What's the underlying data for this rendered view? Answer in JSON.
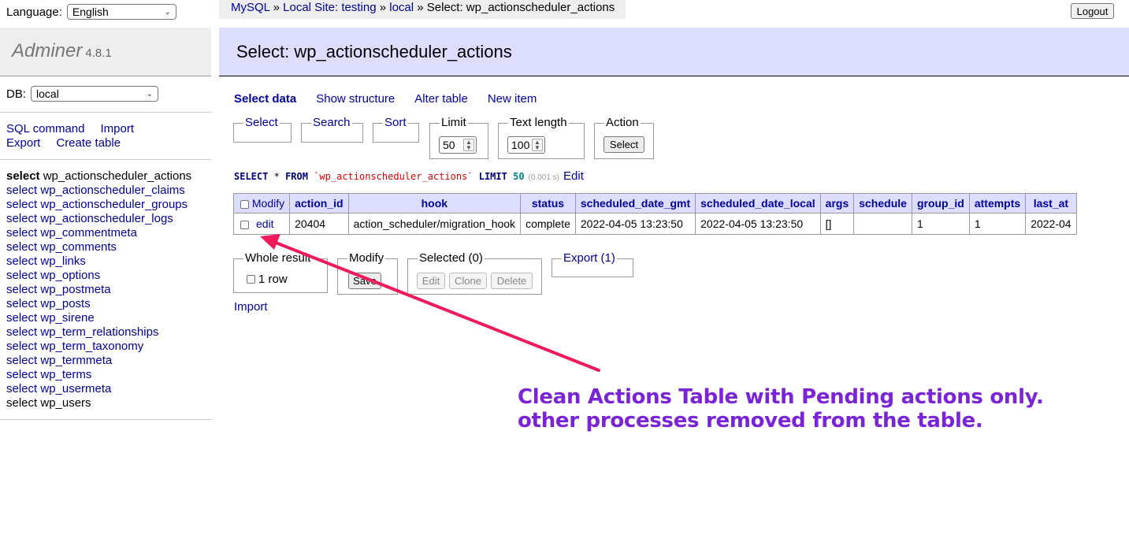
{
  "app": {
    "name": "Adminer",
    "version": "4.8.1"
  },
  "language": {
    "label": "Language:",
    "value": "English"
  },
  "db": {
    "label": "DB:",
    "value": "local"
  },
  "sidebar": {
    "links": [
      "SQL command",
      "Import",
      "Export",
      "Create table"
    ],
    "tables": [
      {
        "verb": "select",
        "name": "wp_actionscheduler_actions",
        "current": true
      },
      {
        "verb": "select",
        "name": "wp_actionscheduler_claims"
      },
      {
        "verb": "select",
        "name": "wp_actionscheduler_groups"
      },
      {
        "verb": "select",
        "name": "wp_actionscheduler_logs"
      },
      {
        "verb": "select",
        "name": "wp_commentmeta"
      },
      {
        "verb": "select",
        "name": "wp_comments"
      },
      {
        "verb": "select",
        "name": "wp_links"
      },
      {
        "verb": "select",
        "name": "wp_options"
      },
      {
        "verb": "select",
        "name": "wp_postmeta"
      },
      {
        "verb": "select",
        "name": "wp_posts"
      },
      {
        "verb": "select",
        "name": "wp_sirene"
      },
      {
        "verb": "select",
        "name": "wp_term_relationships"
      },
      {
        "verb": "select",
        "name": "wp_term_taxonomy"
      },
      {
        "verb": "select",
        "name": "wp_termmeta"
      },
      {
        "verb": "select",
        "name": "wp_terms"
      },
      {
        "verb": "select",
        "name": "wp_usermeta"
      },
      {
        "verb": "select",
        "name": "wp_users",
        "visited": true
      }
    ]
  },
  "breadcrumb": {
    "items": [
      "MySQL",
      "Local Site: testing",
      "local"
    ],
    "separator": "»",
    "current": "Select: wp_actionscheduler_actions"
  },
  "logout_label": "Logout",
  "page_title": "Select: wp_actionscheduler_actions",
  "menu": {
    "select_data": "Select data",
    "show_structure": "Show structure",
    "alter_table": "Alter table",
    "new_item": "New item"
  },
  "form": {
    "select": "Select",
    "search": "Search",
    "sort": "Sort",
    "limit_legend": "Limit",
    "limit_value": "50",
    "text_length_legend": "Text length",
    "text_length_value": "100",
    "action_legend": "Action",
    "action_button": "Select"
  },
  "query": {
    "select_kw": "SELECT",
    "star": "*",
    "from_kw": "FROM",
    "table": "`wp_actionscheduler_actions`",
    "limit_kw": "LIMIT",
    "limit_num": "50",
    "time": "(0.001 s)",
    "edit_label": "Edit"
  },
  "grid": {
    "modify_header": "Modify",
    "columns": [
      "action_id",
      "hook",
      "status",
      "scheduled_date_gmt",
      "scheduled_date_local",
      "args",
      "schedule",
      "group_id",
      "attempts",
      "last_at"
    ],
    "rows": [
      {
        "edit": "edit",
        "cells": [
          "20404",
          "action_scheduler/migration_hook",
          "complete",
          "2022-04-05 13:23:50",
          "2022-04-05 13:23:50",
          "[]",
          "",
          "1",
          "1",
          "2022-04"
        ]
      }
    ]
  },
  "bottom": {
    "whole_result": "Whole result",
    "one_row": "1 row",
    "modify": "Modify",
    "save": "Save",
    "selected": "Selected (0)",
    "edit": "Edit",
    "clone": "Clone",
    "delete": "Delete",
    "export": "Export (1)"
  },
  "import_label": "Import",
  "annotation": {
    "line1": "Clean Actions Table with Pending actions only.",
    "line2": "other processes removed from the table.",
    "color": "#7b23d6",
    "arrow_color": "#f01a5a"
  }
}
